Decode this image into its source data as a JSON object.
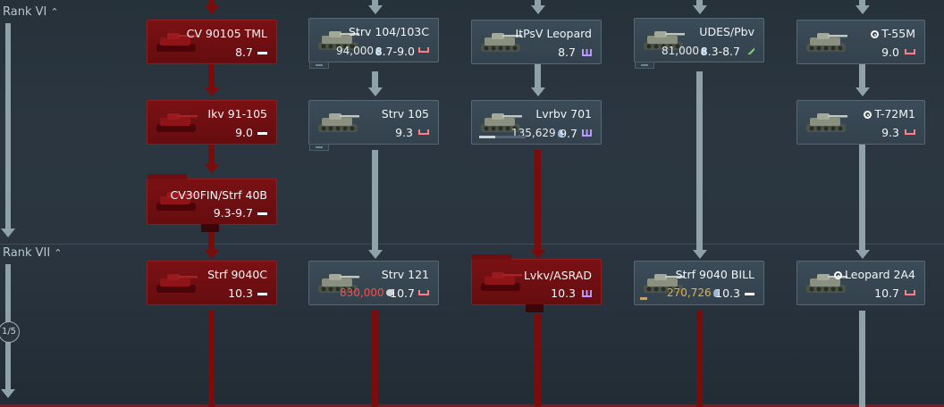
{
  "ranks": [
    {
      "label": "Rank VI"
    },
    {
      "label": "Rank VII"
    }
  ],
  "progress_badge": "1/5",
  "colors": {
    "researched_red": "#7a0c0c",
    "locked_grey": "#8fa2aa",
    "cost_red": "#ff4a4a",
    "cost_gold": "#e0b34a"
  },
  "vehicles": {
    "cv90105": {
      "name": "CV 90105 TML",
      "br": "8.7",
      "icon": "light-tank-icon"
    },
    "strv104": {
      "name": "Strv 104/103C",
      "cost": "94,000",
      "br": "8.7-9.0",
      "icon": "medium-tank-icon"
    },
    "itpsv": {
      "name": "ItPsV Leopard",
      "br": "8.7",
      "icon": "spaa-icon"
    },
    "udes": {
      "name": "UDES/Pbv",
      "cost": "81,000",
      "br": "8.3-8.7",
      "icon": "tank-destroyer-icon"
    },
    "t55m": {
      "name": "T-55M",
      "br": "9.0",
      "icon": "medium-tank-icon"
    },
    "ikv91": {
      "name": "Ikv 91-105",
      "br": "9.0",
      "icon": "light-tank-icon"
    },
    "strv105": {
      "name": "Strv 105",
      "br": "9.3",
      "icon": "medium-tank-icon"
    },
    "lvrbv701": {
      "name": "Lvrbv 701",
      "cost": "135,629",
      "br": "9.7",
      "icon": "spaa-icon",
      "research_progress": 0.35
    },
    "t72m1": {
      "name": "T-72M1",
      "br": "9.3",
      "icon": "medium-tank-icon"
    },
    "cv30fin": {
      "name": "CV30FIN/Strf 40B",
      "br": "9.3-9.7",
      "icon": "light-tank-icon"
    },
    "strf9040c": {
      "name": "Strf 9040C",
      "br": "10.3",
      "icon": "light-tank-icon"
    },
    "strv121": {
      "name": "Strv 121",
      "cost": "830,000",
      "br": "10.7",
      "icon": "medium-tank-icon"
    },
    "lvkv": {
      "name": "Lvkv/ASRAD",
      "br": "10.3",
      "icon": "spaa-icon"
    },
    "strf9040bill": {
      "name": "Strf 9040 BILL",
      "cost": "270,726",
      "br": "10.3",
      "icon": "light-tank-icon"
    },
    "leo2a4": {
      "name": "Leopard 2A4",
      "br": "10.7",
      "icon": "medium-tank-icon"
    }
  }
}
